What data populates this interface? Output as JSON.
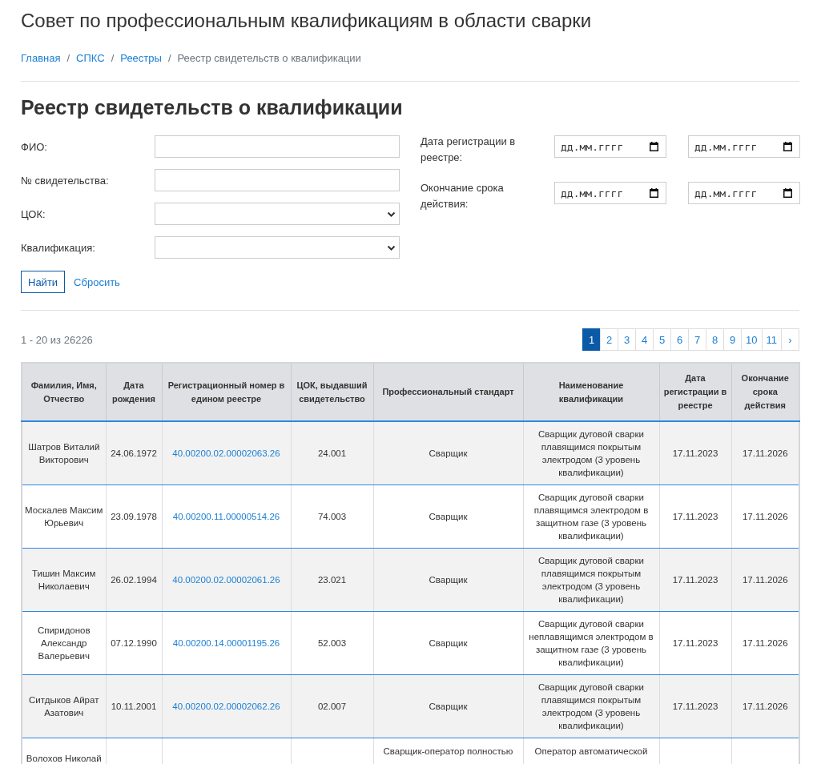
{
  "site_title": "Совет по профессиональным квалификациям в области сварки",
  "breadcrumbs": [
    {
      "label": "Главная",
      "kind": "link"
    },
    {
      "label": "/",
      "kind": "separator"
    },
    {
      "label": "СПКС",
      "kind": "link"
    },
    {
      "label": "/",
      "kind": "separator"
    },
    {
      "label": "Реестры",
      "kind": "link"
    },
    {
      "label": "/",
      "kind": "separator"
    },
    {
      "label": "Реестр свидетельств о квалификации",
      "kind": "current"
    }
  ],
  "page_title": "Реестр свидетельств о квалификации",
  "filters_left": [
    {
      "label": "ФИО:",
      "kind": "text"
    },
    {
      "label": "№ свидетельства:",
      "kind": "text"
    },
    {
      "label": "ЦОК:",
      "kind": "select"
    },
    {
      "label": "Квалификация:",
      "kind": "select"
    }
  ],
  "filters_right": [
    {
      "label": "Дата регистрации в реестре:",
      "fields": [
        {
          "placeholder": "дд.мм.гггг"
        },
        {
          "placeholder": "дд.мм.гггг"
        }
      ]
    },
    {
      "label": "Окончание срока действия:",
      "fields": [
        {
          "placeholder": "дд.мм.гггг"
        },
        {
          "placeholder": "дд.мм.гггг"
        }
      ]
    }
  ],
  "buttons": [
    {
      "label": "Найти",
      "kind": "outline"
    },
    {
      "label": "Сбросить",
      "kind": "link"
    }
  ],
  "result_count": "1 - 20 из 26226",
  "pagination": [
    {
      "label": "1",
      "selected": true
    },
    {
      "label": "2",
      "selected": false
    },
    {
      "label": "3",
      "selected": false
    },
    {
      "label": "4",
      "selected": false
    },
    {
      "label": "5",
      "selected": false
    },
    {
      "label": "6",
      "selected": false
    },
    {
      "label": "7",
      "selected": false
    },
    {
      "label": "8",
      "selected": false
    },
    {
      "label": "9",
      "selected": false
    },
    {
      "label": "10",
      "selected": false
    },
    {
      "label": "11",
      "selected": false
    },
    {
      "label": "›",
      "selected": false
    }
  ],
  "table": {
    "columns": [
      "Фамилия, Имя, Отчество",
      "Дата рождения",
      "Регистрационный номер в едином реестре",
      "ЦОК, выдавший свидетельство",
      "Профессиональный стандарт",
      "Наименование квалификации",
      "Дата регистрации в реестре",
      "Окончание срока действия"
    ],
    "rows": [
      {
        "name": "Шатров Виталий Викторович",
        "birth_date": "24.06.1972",
        "reg_number": "40.00200.02.00002063.26",
        "center": "24.001",
        "standard": "Сварщик",
        "qualification": "Сварщик дуговой сварки плавящимся покрытым электродом (3 уровень квалификации)",
        "reg_date": "17.11.2023",
        "end_date": "17.11.2026"
      },
      {
        "name": "Москалев Максим Юрьевич",
        "birth_date": "23.09.1978",
        "reg_number": "40.00200.11.00000514.26",
        "center": "74.003",
        "standard": "Сварщик",
        "qualification": "Сварщик дуговой сварки плавящимся электродом в защитном газе (3 уровень квалификации)",
        "reg_date": "17.11.2023",
        "end_date": "17.11.2026"
      },
      {
        "name": "Тишин Максим Николаевич",
        "birth_date": "26.02.1994",
        "reg_number": "40.00200.02.00002061.26",
        "center": "23.021",
        "standard": "Сварщик",
        "qualification": "Сварщик дуговой сварки плавящимся покрытым электродом (3 уровень квалификации)",
        "reg_date": "17.11.2023",
        "end_date": "17.11.2026"
      },
      {
        "name": "Спиридонов Александр Валерьевич",
        "birth_date": "07.12.1990",
        "reg_number": "40.00200.14.00001195.26",
        "center": "52.003",
        "standard": "Сварщик",
        "qualification": "Сварщик дуговой сварки неплавящимся электродом в защитном газе (3 уровень квалификации)",
        "reg_date": "17.11.2023",
        "end_date": "17.11.2026"
      },
      {
        "name": "Ситдыков Айрат Азатович",
        "birth_date": "10.11.2001",
        "reg_number": "40.00200.02.00002062.26",
        "center": "02.007",
        "standard": "Сварщик",
        "qualification": "Сварщик дуговой сварки плавящимся покрытым электродом (3 уровень квалификации)",
        "reg_date": "17.11.2023",
        "end_date": "17.11.2026"
      },
      {
        "name": "Волохов Николай",
        "standard": "Сварщик-оператор полностью",
        "qualification": "Оператор автоматической"
      }
    ]
  }
}
